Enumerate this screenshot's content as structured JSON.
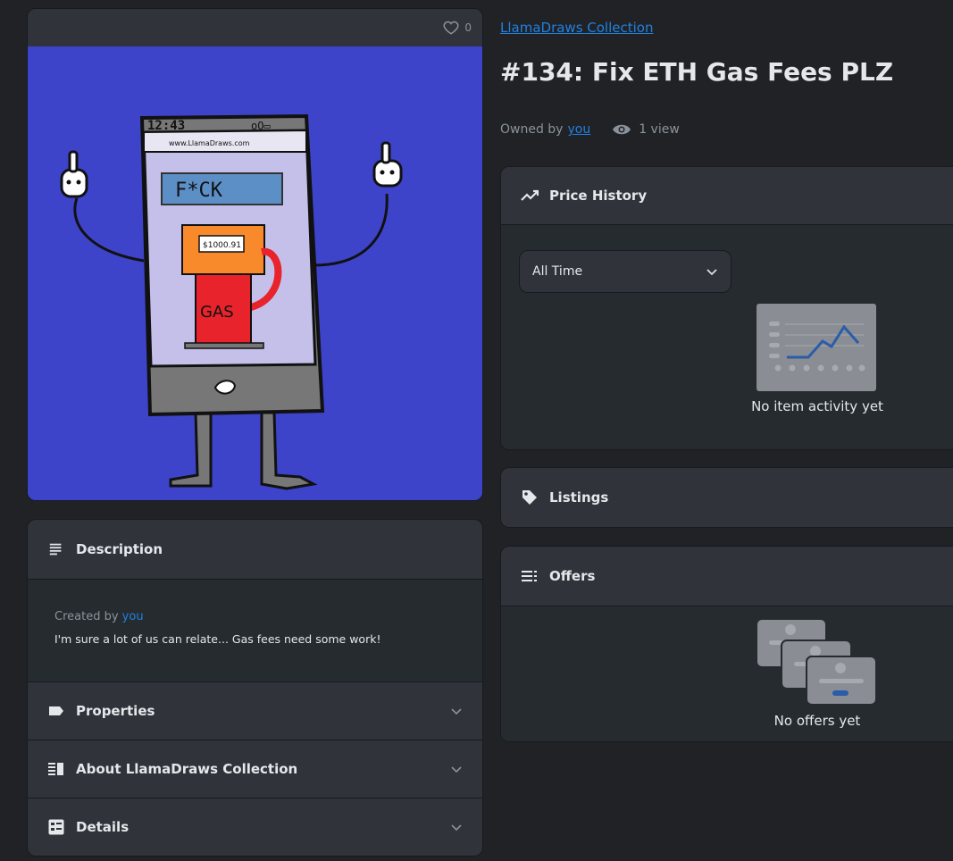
{
  "item": {
    "favorites_count": "0",
    "collection_name": "LlamaDraws Collection",
    "title": "#134: Fix ETH Gas Fees PLZ",
    "owned_by_label": "Owned by",
    "owner": "you",
    "views": "1 view"
  },
  "artwork": {
    "clock": "12:43",
    "url_bar": "www.LlamaDraws.com",
    "screen_text": "F*CK",
    "pump_price": "$1000.91",
    "pump_label": "GAS",
    "colors": {
      "background": "#3d44c9",
      "screen": "#c5c0ea",
      "pump_top": "#f98a2c",
      "pump_body": "#e8232b",
      "phone_body": "#7a7a7a"
    }
  },
  "description": {
    "header": "Description",
    "created_by_label": "Created by",
    "creator": "you",
    "text": "I'm sure a lot of us can relate... Gas fees need some work!"
  },
  "accordions": {
    "properties": "Properties",
    "about": "About LlamaDraws Collection",
    "details": "Details"
  },
  "price_history": {
    "header": "Price History",
    "time_filter": "All Time",
    "empty": "No item activity yet"
  },
  "listings": {
    "header": "Listings"
  },
  "offers": {
    "header": "Offers",
    "empty": "No offers yet"
  },
  "colors": {
    "link": "#2081e2",
    "panel": "#303339",
    "panel_body": "#262b2f",
    "page": "#202225"
  }
}
